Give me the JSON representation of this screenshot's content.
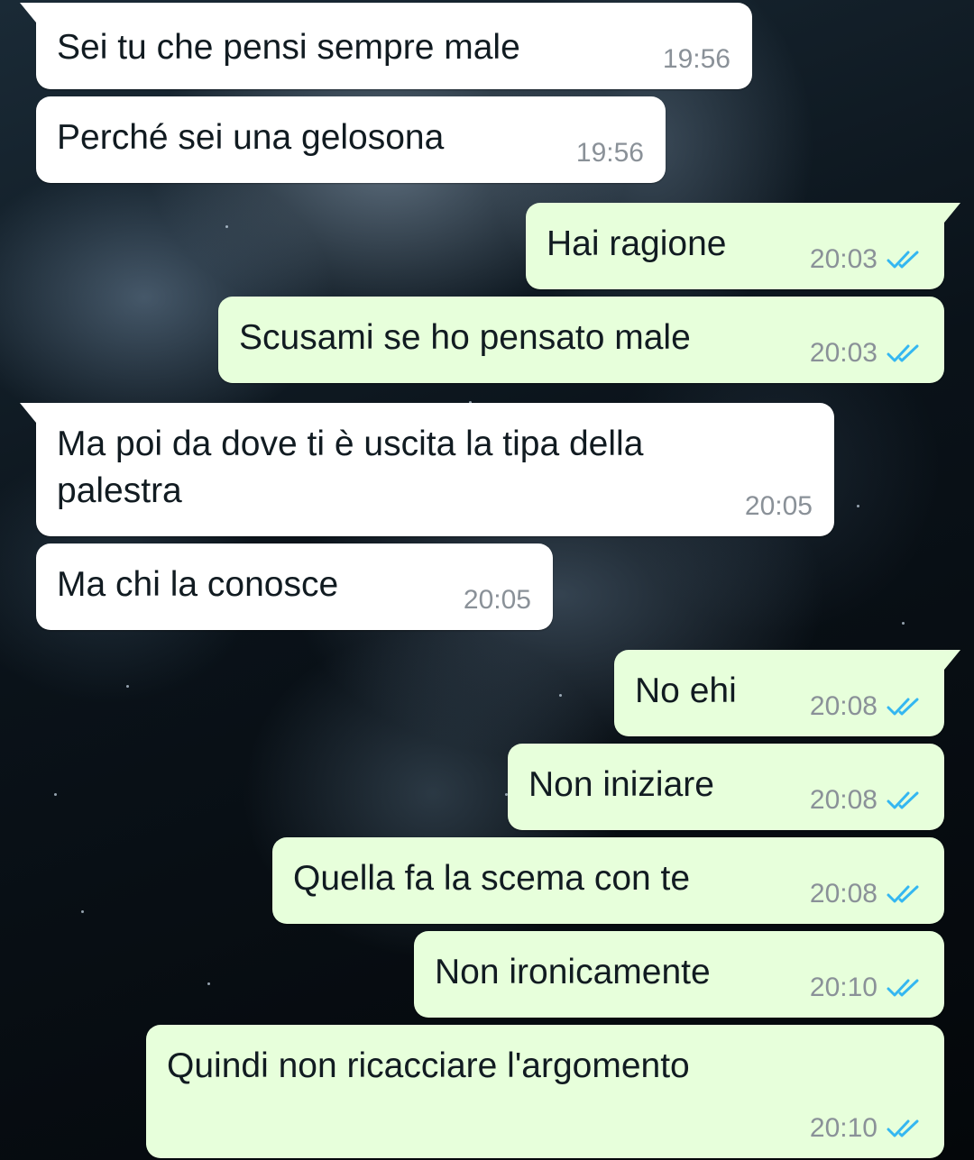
{
  "colors": {
    "incoming_bubble": "#ffffff",
    "outgoing_bubble": "#e7ffdb",
    "timestamp": "#8a9198",
    "read_receipt": "#34b7f1",
    "text": "#111b21"
  },
  "messages": [
    {
      "direction": "in",
      "text": "Sei tu che pensi sempre male",
      "time": "19:56"
    },
    {
      "direction": "in",
      "text": "Perché sei una gelosona",
      "time": "19:56"
    },
    {
      "direction": "out",
      "text": "Hai ragione",
      "time": "20:03",
      "status": "read"
    },
    {
      "direction": "out",
      "text": "Scusami se ho pensato male",
      "time": "20:03",
      "status": "read"
    },
    {
      "direction": "in",
      "text": "Ma poi da dove ti è uscita la tipa della palestra",
      "time": "20:05"
    },
    {
      "direction": "in",
      "text": "Ma chi la conosce",
      "time": "20:05"
    },
    {
      "direction": "out",
      "text": "No ehi",
      "time": "20:08",
      "status": "read"
    },
    {
      "direction": "out",
      "text": "Non iniziare",
      "time": "20:08",
      "status": "read"
    },
    {
      "direction": "out",
      "text": "Quella fa la scema con te",
      "time": "20:08",
      "status": "read"
    },
    {
      "direction": "out",
      "text": "Non ironicamente",
      "time": "20:10",
      "status": "read"
    },
    {
      "direction": "out",
      "text": "Quindi non ricacciare l'argomento",
      "time": "20:10",
      "status": "read"
    }
  ]
}
